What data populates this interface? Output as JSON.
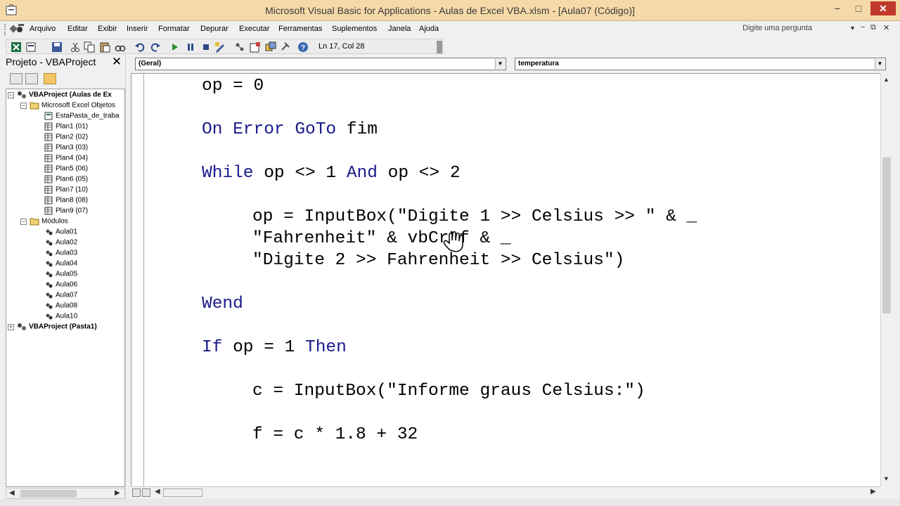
{
  "window": {
    "title": "Microsoft Visual Basic for Applications - Aulas de Excel VBA.xlsm - [Aula07 (Código)]",
    "minimize": "−",
    "maximize": "□",
    "close": "✕"
  },
  "menu": {
    "items": [
      "Arquivo",
      "Editar",
      "Exibir",
      "Inserir",
      "Formatar",
      "Depurar",
      "Executar",
      "Ferramentas",
      "Suplementos",
      "Janela",
      "Ajuda"
    ],
    "ask_placeholder": "Digite uma pergunta",
    "mdi_min": "−",
    "mdi_restore": "⧉",
    "mdi_close": "✕"
  },
  "toolbar": {
    "cursor_position": "Ln 17, Col 28",
    "icons": [
      "excel-view-icon",
      "insert-module-icon",
      "save-icon",
      "cut-icon",
      "copy-icon",
      "paste-icon",
      "find-icon",
      "undo-icon",
      "redo-icon",
      "run-icon",
      "break-icon",
      "reset-icon",
      "design-mode-icon",
      "project-explorer-icon",
      "properties-icon",
      "object-browser-icon",
      "toolbox-icon",
      "help-icon"
    ]
  },
  "project_panel": {
    "title": "Projeto - VBAProject",
    "close": "✕",
    "tree": [
      {
        "label": "VBAProject (Aulas de Ex",
        "level": 0,
        "bold": true,
        "expander": "−",
        "icon": "vba-project-icon"
      },
      {
        "label": "Microsoft Excel Objetos",
        "level": 1,
        "bold": false,
        "expander": "−",
        "icon": "folder-icon"
      },
      {
        "label": "EstaPasta_de_traba",
        "level": 2,
        "bold": false,
        "expander": "",
        "icon": "workbook-icon"
      },
      {
        "label": "Plan1 (01)",
        "level": 2,
        "bold": false,
        "expander": "",
        "icon": "sheet-icon"
      },
      {
        "label": "Plan2 (02)",
        "level": 2,
        "bold": false,
        "expander": "",
        "icon": "sheet-icon"
      },
      {
        "label": "Plan3 (03)",
        "level": 2,
        "bold": false,
        "expander": "",
        "icon": "sheet-icon"
      },
      {
        "label": "Plan4 (04)",
        "level": 2,
        "bold": false,
        "expander": "",
        "icon": "sheet-icon"
      },
      {
        "label": "Plan5 (06)",
        "level": 2,
        "bold": false,
        "expander": "",
        "icon": "sheet-icon"
      },
      {
        "label": "Plan6 (05)",
        "level": 2,
        "bold": false,
        "expander": "",
        "icon": "sheet-icon"
      },
      {
        "label": "Plan7 (10)",
        "level": 2,
        "bold": false,
        "expander": "",
        "icon": "sheet-icon"
      },
      {
        "label": "Plan8 (08)",
        "level": 2,
        "bold": false,
        "expander": "",
        "icon": "sheet-icon"
      },
      {
        "label": "Plan9 (07)",
        "level": 2,
        "bold": false,
        "expander": "",
        "icon": "sheet-icon"
      },
      {
        "label": "Módulos",
        "level": 1,
        "bold": false,
        "expander": "−",
        "icon": "folder-icon"
      },
      {
        "label": "Aula01",
        "level": 2,
        "bold": false,
        "expander": "",
        "icon": "module-icon"
      },
      {
        "label": "Aula02",
        "level": 2,
        "bold": false,
        "expander": "",
        "icon": "module-icon"
      },
      {
        "label": "Aula03",
        "level": 2,
        "bold": false,
        "expander": "",
        "icon": "module-icon"
      },
      {
        "label": "Aula04",
        "level": 2,
        "bold": false,
        "expander": "",
        "icon": "module-icon"
      },
      {
        "label": "Aula05",
        "level": 2,
        "bold": false,
        "expander": "",
        "icon": "module-icon"
      },
      {
        "label": "Aula06",
        "level": 2,
        "bold": false,
        "expander": "",
        "icon": "module-icon"
      },
      {
        "label": "Aula07",
        "level": 2,
        "bold": false,
        "expander": "",
        "icon": "module-icon"
      },
      {
        "label": "Aula08",
        "level": 2,
        "bold": false,
        "expander": "",
        "icon": "module-icon"
      },
      {
        "label": "Aula10",
        "level": 2,
        "bold": false,
        "expander": "",
        "icon": "module-icon"
      },
      {
        "label": "VBAProject (Pasta1)",
        "level": 0,
        "bold": true,
        "expander": "+",
        "icon": "vba-project-icon"
      }
    ]
  },
  "code_window": {
    "object_combo": "(Geral)",
    "procedure_combo": "temperatura",
    "lines": [
      [
        {
          "t": "op = 0",
          "k": false
        }
      ],
      [
        {
          "t": "On Error GoTo",
          "k": true
        },
        {
          "t": " fim",
          "k": false
        }
      ],
      [
        {
          "t": "While",
          "k": true
        },
        {
          "t": " op <> 1 ",
          "k": false
        },
        {
          "t": "And",
          "k": true
        },
        {
          "t": " op <> 2",
          "k": false
        }
      ],
      [
        {
          "t": "op = InputBox(\"Digite 1 >> Celsius >> \" & _",
          "k": false
        }
      ],
      [
        {
          "t": "\"Fahrenheit\" & vbCrLf & _",
          "k": false
        }
      ],
      [
        {
          "t": "\"Digite 2 >> Fahrenheit >> Celsius\")",
          "k": false
        }
      ],
      [
        {
          "t": "Wend",
          "k": true
        }
      ],
      [
        {
          "t": "If",
          "k": true
        },
        {
          "t": " op = 1 ",
          "k": false
        },
        {
          "t": "Then",
          "k": true
        }
      ],
      [
        {
          "t": "c = InputBox(\"Informe graus Celsius:\")",
          "k": false
        }
      ],
      [
        {
          "t": "f = c * 1.8 + 32",
          "k": false
        }
      ]
    ]
  },
  "colors": {
    "keyword": "#1a1a8c",
    "titlebar": "#f5d9a8"
  }
}
